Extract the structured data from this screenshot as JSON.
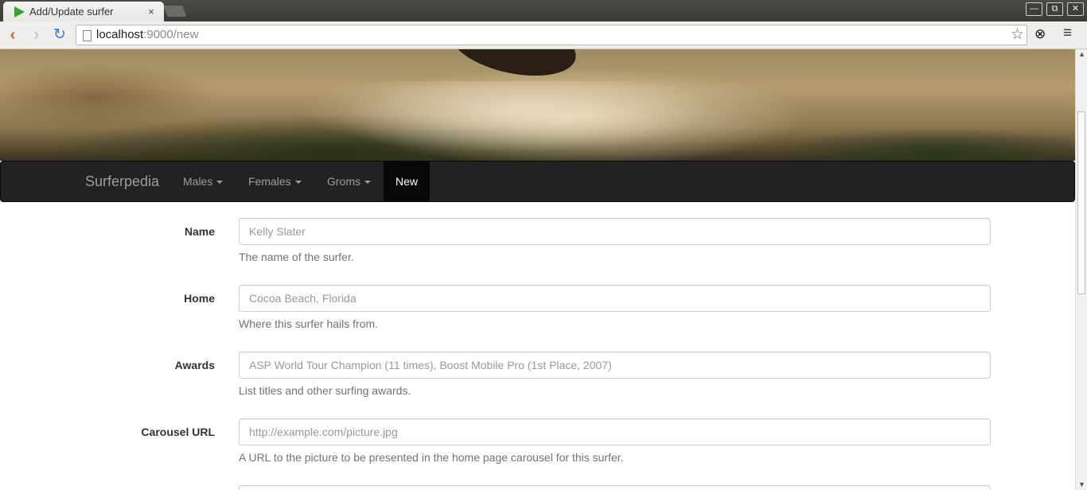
{
  "browser": {
    "tab_title": "Add/Update surfer",
    "tab_close": "×",
    "url_host": "localhost",
    "url_path": ":9000/new",
    "back_icon": "‹",
    "forward_icon": "›",
    "reload_icon": "↻",
    "star_icon": "☆",
    "menu_icon": "≡",
    "window_controls": {
      "minimize": "—",
      "restore": "⧉",
      "close": "✕"
    }
  },
  "navbar": {
    "brand": "Surferpedia",
    "items": [
      {
        "label": "Males",
        "dropdown": true,
        "active": false
      },
      {
        "label": "Females",
        "dropdown": true,
        "active": false
      },
      {
        "label": "Groms",
        "dropdown": true,
        "active": false
      },
      {
        "label": "New",
        "dropdown": false,
        "active": true
      }
    ]
  },
  "form": {
    "fields": [
      {
        "label": "Name",
        "value": "",
        "placeholder": "Kelly Slater",
        "help": "The name of the surfer."
      },
      {
        "label": "Home",
        "value": "",
        "placeholder": "Cocoa Beach, Florida",
        "help": "Where this surfer hails from."
      },
      {
        "label": "Awards",
        "value": "",
        "placeholder": "ASP World Tour Champion (11 times), Boost Mobile Pro (1st Place, 2007)",
        "help": "List titles and other surfing awards."
      },
      {
        "label": "Carousel URL",
        "value": "",
        "placeholder": "http://example.com/picture.jpg",
        "help": "A URL to the picture to be presented in the home page carousel for this surfer."
      }
    ]
  }
}
